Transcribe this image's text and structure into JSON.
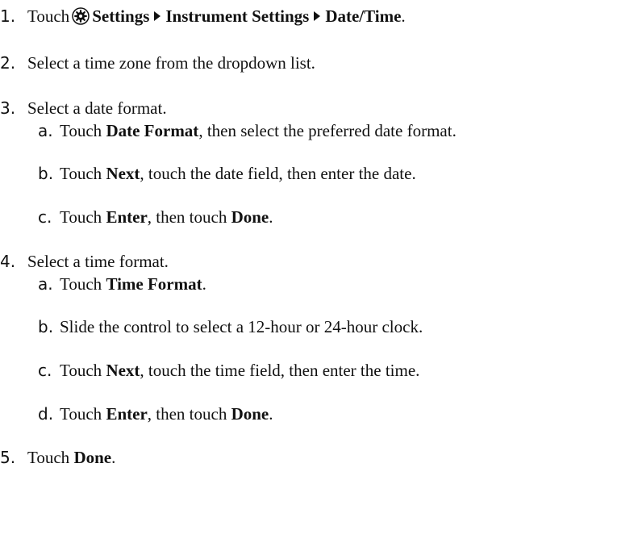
{
  "steps": [
    {
      "num": "1.",
      "touch": "Touch",
      "settings": "Settings",
      "instrument_settings": "Instrument Settings",
      "date_time": "Date/Time",
      "end": "."
    },
    {
      "num": "2.",
      "text": "Select a time zone from the dropdown list."
    },
    {
      "num": "3.",
      "text": "Select a date format.",
      "sub": [
        {
          "num": "a.",
          "pre": "Touch ",
          "b1": "Date Format",
          "post": ", then select the preferred date format."
        },
        {
          "num": "b.",
          "pre": "Touch ",
          "b1": "Next",
          "post": ", touch the date field, then enter the date."
        },
        {
          "num": "c.",
          "pre": "Touch ",
          "b1": "Enter",
          "mid": ", then touch ",
          "b2": "Done",
          "post": "."
        }
      ]
    },
    {
      "num": "4.",
      "text": "Select a time format.",
      "sub": [
        {
          "num": "a.",
          "pre": "Touch ",
          "b1": "Time Format",
          "post": "."
        },
        {
          "num": "b.",
          "text": "Slide the control to select a 12-hour or 24-hour clock."
        },
        {
          "num": "c.",
          "pre": "Touch ",
          "b1": "Next",
          "post": ", touch the time field, then enter the time."
        },
        {
          "num": "d.",
          "pre": "Touch ",
          "b1": "Enter",
          "mid": ", then touch ",
          "b2": "Done",
          "post": "."
        }
      ]
    },
    {
      "num": "5.",
      "pre": "Touch ",
      "b1": "Done",
      "post": "."
    }
  ],
  "icons": {
    "settings": "gear-icon",
    "separator": "right-triangle-icon"
  }
}
